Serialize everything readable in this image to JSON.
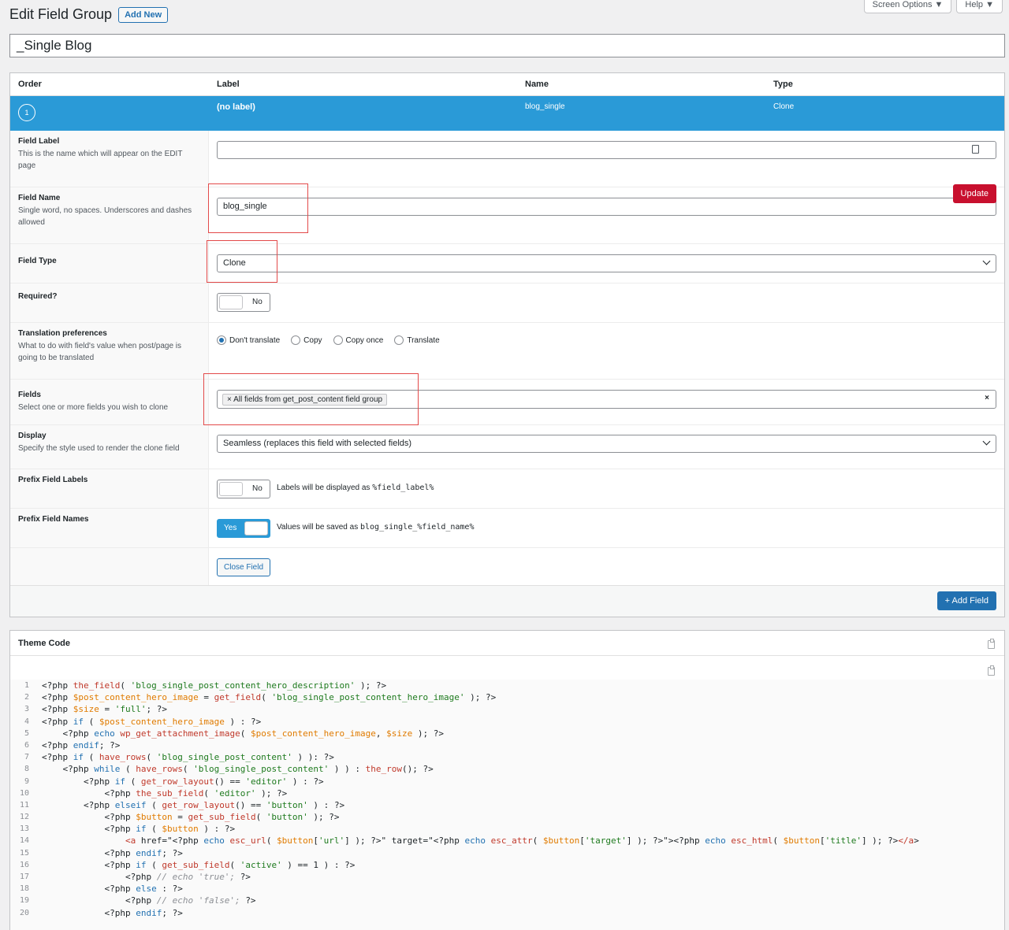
{
  "header": {
    "page_title": "Edit Field Group",
    "add_new_label": "Add New",
    "screen_options_label": "Screen Options ▼",
    "help_label": "Help ▼"
  },
  "group_title_value": "_Single Blog",
  "fields_table": {
    "headers": {
      "order": "Order",
      "label": "Label",
      "name": "Name",
      "type": "Type"
    },
    "field": {
      "order": "1",
      "label": "(no label)",
      "name": "blog_single",
      "type": "Clone"
    }
  },
  "settings": {
    "field_label": {
      "title": "Field Label",
      "desc": "This is the name which will appear on the EDIT page",
      "value": ""
    },
    "field_name": {
      "title": "Field Name",
      "desc": "Single word, no spaces. Underscores and dashes allowed",
      "value": "blog_single",
      "update_label": "Update"
    },
    "field_type": {
      "title": "Field Type",
      "value": "Clone"
    },
    "required": {
      "title": "Required?",
      "toggle": "No"
    },
    "translation": {
      "title": "Translation preferences",
      "desc": "What to do with field's value when post/page is going to be translated",
      "options": [
        "Don't translate",
        "Copy",
        "Copy once",
        "Translate"
      ],
      "selected": "Don't translate"
    },
    "fields": {
      "title": "Fields",
      "desc": "Select one or more fields you wish to clone",
      "chip": "× All fields from get_post_content field group",
      "clear": "×"
    },
    "display": {
      "title": "Display",
      "desc": "Specify the style used to render the clone field",
      "value": "Seamless (replaces this field with selected fields)"
    },
    "prefix_labels": {
      "title": "Prefix Field Labels",
      "toggle": "No",
      "note_pre": "Labels will be displayed as ",
      "note_code": "%field_label%"
    },
    "prefix_names": {
      "title": "Prefix Field Names",
      "toggle": "Yes",
      "note_pre": "Values will be saved as ",
      "note_code": "blog_single_%field_name%"
    },
    "close_field_label": "Close Field"
  },
  "add_field_label": "+ Add Field",
  "theme_code": {
    "title": "Theme Code",
    "lines": [
      "<?php the_field( 'blog_single_post_content_hero_description' ); ?>",
      "<?php $post_content_hero_image = get_field( 'blog_single_post_content_hero_image' ); ?>",
      "<?php $size = 'full'; ?>",
      "<?php if ( $post_content_hero_image ) : ?>",
      "    <?php echo wp_get_attachment_image( $post_content_hero_image, $size ); ?>",
      "<?php endif; ?>",
      "<?php if ( have_rows( 'blog_single_post_content' ) ): ?>",
      "    <?php while ( have_rows( 'blog_single_post_content' ) ) : the_row(); ?>",
      "        <?php if ( get_row_layout() == 'editor' ) : ?>",
      "            <?php the_sub_field( 'editor' ); ?>",
      "        <?php elseif ( get_row_layout() == 'button' ) : ?>",
      "            <?php $button = get_sub_field( 'button' ); ?>",
      "            <?php if ( $button ) : ?>",
      "                <a href=\"<?php echo esc_url( $button['url'] ); ?>\" target=\"<?php echo esc_attr( $button['target'] ); ?>\"><?php echo esc_html( $button['title'] ); ?></a>",
      "            <?php endif; ?>",
      "            <?php if ( get_sub_field( 'active' ) == 1 ) : ?>",
      "                <?php // echo 'true'; ?>",
      "            <?php else : ?>",
      "                <?php // echo 'false'; ?>",
      "            <?php endif; ?>"
    ]
  }
}
